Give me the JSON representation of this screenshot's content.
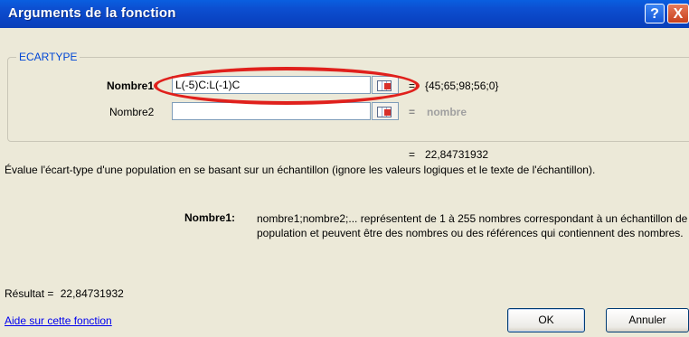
{
  "window": {
    "title": "Arguments de la fonction",
    "help_glyph": "?",
    "close_glyph": "X"
  },
  "function_group": {
    "name": "ECARTYPE"
  },
  "arguments": [
    {
      "label": "Nombre1",
      "input_value": "L(-5)C:L(-1)C",
      "eq": "=",
      "evaluated": "{45;65;98;56;0}"
    },
    {
      "label": "Nombre2",
      "input_value": "",
      "eq": "=",
      "evaluated": "nombre"
    }
  ],
  "formula_result": {
    "eq": "=",
    "value": "22,84731932"
  },
  "description": "Évalue l'écart-type d'une population en se basant sur un échantillon (ignore les valeurs logiques et le texte de l'échantillon).",
  "arg_help": {
    "name": "Nombre1:",
    "text": "nombre1;nombre2;... représentent de 1 à 255 nombres correspondant à un échantillon de population et peuvent être des nombres ou des références qui contiennent des nombres."
  },
  "result": {
    "label": "Résultat =",
    "value": "22,84731932"
  },
  "help_link": "Aide sur cette fonction",
  "buttons": {
    "ok": "OK",
    "cancel": "Annuler"
  },
  "colors": {
    "titlebar": "#0a4fd1",
    "group_label": "#0046d5",
    "highlight_oval": "#e0201c"
  }
}
